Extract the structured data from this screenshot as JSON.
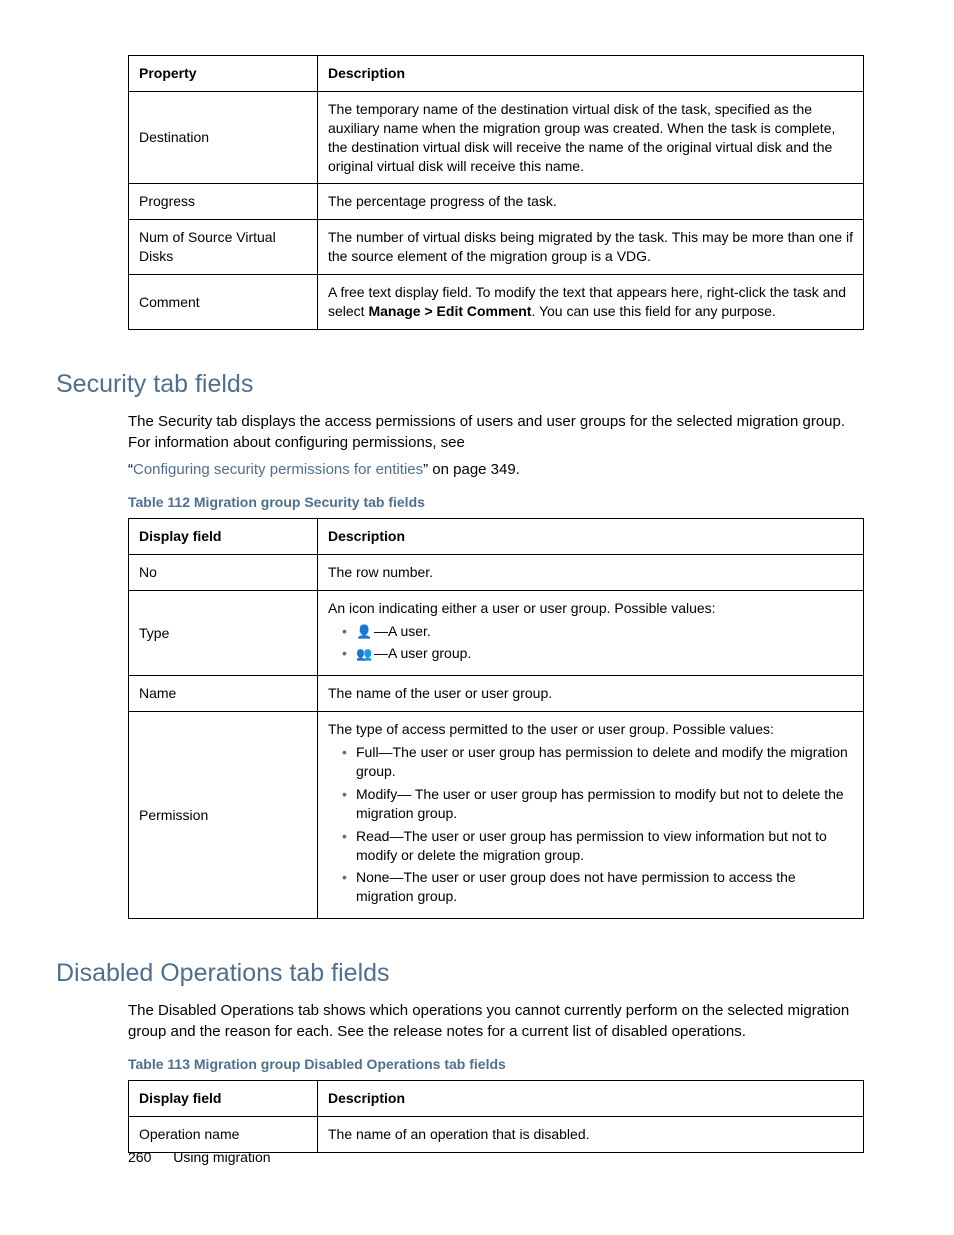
{
  "table1": {
    "headers": [
      "Property",
      "Description"
    ],
    "rows": [
      {
        "prop": "Destination",
        "desc": "The temporary name of the destination virtual disk of the task, specified as the auxiliary name when the migration group was created. When the task is complete, the destination virtual disk will receive the name of the original virtual disk and the original virtual disk will receive this name."
      },
      {
        "prop": "Progress",
        "desc": "The percentage progress of the task."
      },
      {
        "prop": "Num of Source Virtual Disks",
        "desc": "The number of virtual disks being migrated by the task. This may be more than one if the source element of the migration group is a VDG."
      }
    ],
    "comment_row": {
      "prop": "Comment",
      "desc_pre": "A free text display field. To modify the text that appears here, right-click the task and select ",
      "desc_bold": "Manage > Edit Comment",
      "desc_post": ". You can use this field for any purpose."
    }
  },
  "security": {
    "heading": "Security tab fields",
    "intro": "The Security tab displays the access permissions of users and user groups for the selected migration group. For information about configuring permissions, see",
    "link_prefix": "“",
    "link_text": "Configuring security permissions for entities",
    "link_suffix": "” on page 349.",
    "caption": "Table 112 Migration group Security tab fields",
    "headers": [
      "Display field",
      "Description"
    ],
    "rows": {
      "no": {
        "field": "No",
        "desc": "The row number."
      },
      "type": {
        "field": "Type",
        "intro": "An icon indicating either a user or user group. Possible values:",
        "user": "—A user.",
        "group": "—A user group."
      },
      "name": {
        "field": "Name",
        "desc": "The name of the user or user group."
      },
      "permission": {
        "field": "Permission",
        "intro": "The type of access permitted to the user or user group. Possible values:",
        "full": "Full—The user or user group has permission to delete and modify the migration group.",
        "modify": "Modify— The user or user group has permission to modify but not to delete the migration group.",
        "read": "Read—The user or user group has permission to view information but not to modify or delete the migration group.",
        "none": "None—The user or user group does not have permission to access the migration group."
      }
    }
  },
  "disabled": {
    "heading": "Disabled Operations tab fields",
    "intro": "The Disabled Operations tab shows which operations you cannot currently perform on the selected migration group and the reason for each. See the release notes for a current list of disabled operations.",
    "caption": "Table 113 Migration group Disabled Operations tab fields",
    "headers": [
      "Display field",
      "Description"
    ],
    "row": {
      "field": "Operation name",
      "desc": "The name of an operation that is disabled."
    }
  },
  "footer": {
    "page": "260",
    "section": "Using migration"
  }
}
